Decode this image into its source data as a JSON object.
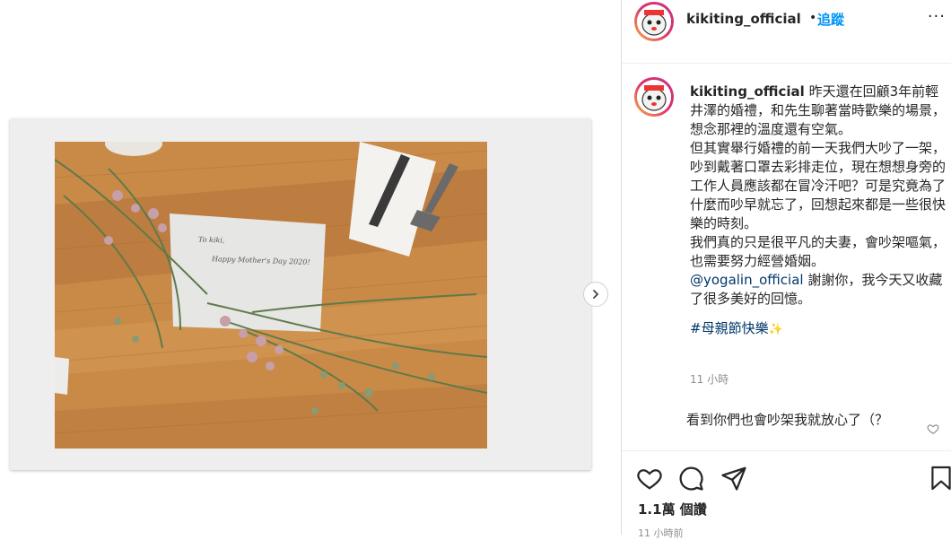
{
  "post": {
    "username": "kikiting_official",
    "separator": "•",
    "follow_label": "追蹤",
    "more_label": "···",
    "caption": {
      "username": "kikiting_official",
      "line1": "昨天還在回顧3年前輕井澤的婚禮，和先生聊著當時歡樂的場景，想念那裡的溫度還有空氣。",
      "line2": "但其實舉行婚禮的前一天我們大吵了一架，吵到戴著口罩去彩排走位，現在想想身旁的工作人員應該都在冒冷汗吧？可是究竟為了什麼而吵早就忘了，回想起來都是一些很快樂的時刻。",
      "line3": "我們真的只是很平凡的夫妻，會吵架嘔氣，也需要努力經營婚姻。",
      "mention": "@yogalin_official",
      "line4": "謝謝你，我今天又收藏了很多美好的回憶。",
      "hashtag": "#母親節快樂",
      "hashtag_emoji": "✨"
    },
    "timestamp": "11 小時",
    "comment_text": "看到你們也會吵架我就放心了（？",
    "likes": "1.1萬 個讚",
    "time_footer": "11 小時前",
    "photo_card": {
      "line1": "To kiki,",
      "line2": "Happy Mother's Day 2020!"
    }
  },
  "icons": {
    "next": "chevron-right-icon",
    "like": "heart-icon",
    "comment": "comment-icon",
    "share": "paper-plane-icon",
    "save": "bookmark-icon",
    "comment_like": "heart-icon"
  },
  "colors": {
    "link": "#0095f6",
    "mention": "#00376b",
    "muted": "#8e8e8e"
  }
}
